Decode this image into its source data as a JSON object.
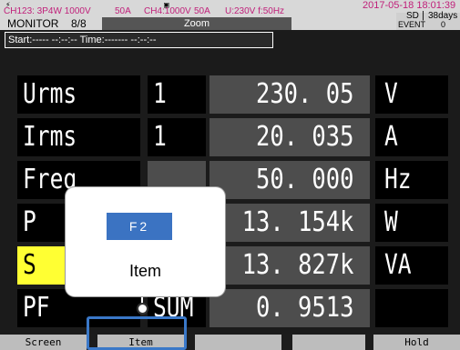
{
  "header": {
    "channels_1": "CH123:  3P4W    1000V",
    "channels_1b": "50A",
    "channels_2": "CH4:1000V",
    "channels_2b": "50A",
    "voltage_freq": "U:230V  f:50Hz",
    "datetime": "2017-05-18  18:01:39",
    "mode": "MONITOR",
    "page": "8/8",
    "view": "Zoom",
    "storage": "SD",
    "days": "38days",
    "event_label": "EVENT",
    "event_count": "0",
    "clamp_icon": "clamp-icon",
    "power_icon": "plug-icon"
  },
  "startbar": {
    "text": "Start:----- --:--:--  Time:------- --:--:--"
  },
  "rows": [
    {
      "name": "Urms",
      "channel": "1",
      "value": "230. 05",
      "unit": "V",
      "highlight": false
    },
    {
      "name": "Irms",
      "channel": "1",
      "value": "20. 035",
      "unit": "A",
      "highlight": false
    },
    {
      "name": "Freq",
      "channel": "",
      "value": "50. 000",
      "unit": "Hz",
      "highlight": false
    },
    {
      "name": "P",
      "channel": "",
      "value": "13. 154k",
      "unit": "W",
      "highlight": false
    },
    {
      "name": "S",
      "channel": "",
      "value": "13. 827k",
      "unit": "VA",
      "highlight": true
    },
    {
      "name": "PF",
      "channel": "SUM",
      "value": "0. 9513",
      "unit": "",
      "highlight": false
    }
  ],
  "function_keys": [
    "Screen",
    "Item",
    "",
    "",
    "Hold"
  ],
  "popup": {
    "key_label": "F2",
    "description": "Item"
  },
  "colors": {
    "highlight": "#ffff33",
    "callout_key": "#3b73c2",
    "accent_chan": "#c0207a"
  }
}
